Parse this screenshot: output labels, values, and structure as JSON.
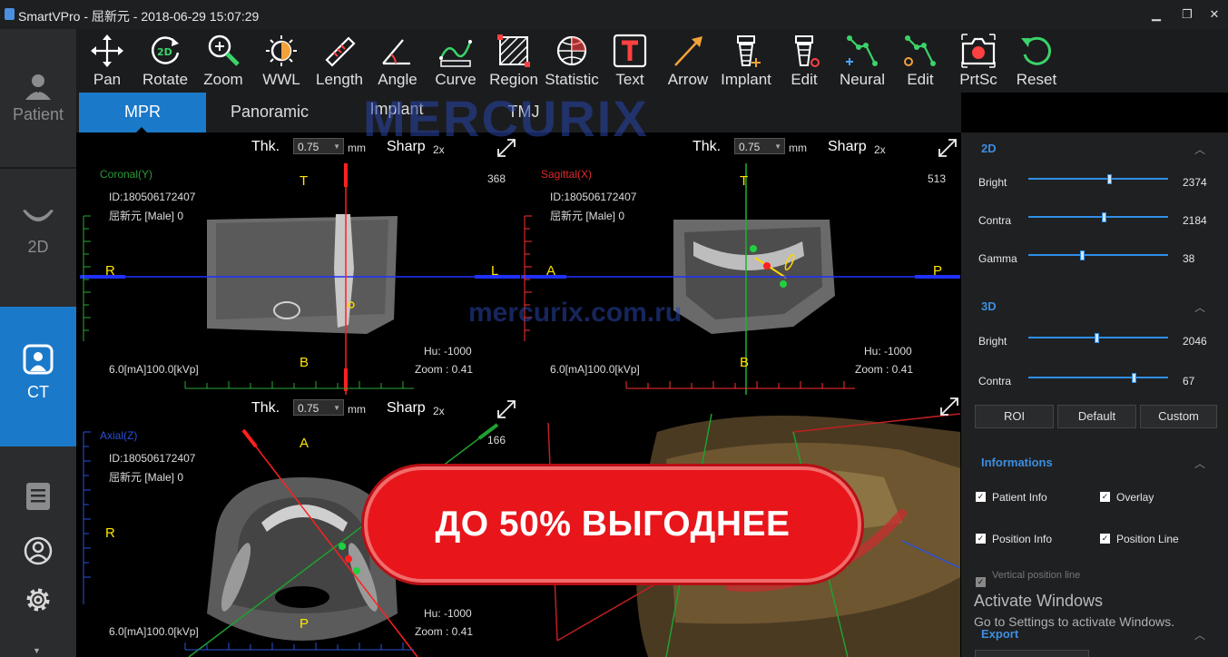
{
  "titlebar": {
    "title": "SmartVPro - 屈新元 - 2018-06-29 15:07:29",
    "min": "▁",
    "max": "❐",
    "close": "✕"
  },
  "nav": {
    "patient": "Patient",
    "twod": "2D",
    "ct": "CT",
    "report": "R",
    "accent": "#1b79c9"
  },
  "toolbar": [
    {
      "label": "Pan",
      "icon": "pan-icon"
    },
    {
      "label": "Rotate",
      "icon": "rotate-icon"
    },
    {
      "label": "Zoom",
      "icon": "zoom-icon"
    },
    {
      "label": "WWL",
      "icon": "wwl-icon"
    },
    {
      "label": "Length",
      "icon": "ruler-icon"
    },
    {
      "label": "Angle",
      "icon": "angle-icon"
    },
    {
      "label": "Curve",
      "icon": "curve-icon"
    },
    {
      "label": "Region",
      "icon": "region-icon"
    },
    {
      "label": "Statistic",
      "icon": "statistic-icon"
    },
    {
      "label": "Text",
      "icon": "text-icon"
    },
    {
      "label": "Arrow",
      "icon": "arrow-icon"
    },
    {
      "label": "Implant",
      "icon": "implant-icon"
    },
    {
      "label": "Edit",
      "icon": "implant-edit-icon"
    },
    {
      "label": "Neural",
      "icon": "neural-icon"
    },
    {
      "label": "Edit",
      "icon": "neural-edit-icon"
    },
    {
      "label": "PrtSc",
      "icon": "camera-icon"
    },
    {
      "label": "Reset",
      "icon": "reset-icon"
    }
  ],
  "tabs": [
    "MPR",
    "Panoramic",
    "Implant",
    "TMJ"
  ],
  "views": {
    "thk_label": "Thk.",
    "thk_value": "0.75",
    "mm": "mm",
    "sharp": "Sharp",
    "sharp_x": "2x",
    "patient_id": "ID:180506172407",
    "patient_name": "屈新元 [Male] 0",
    "exposure": "6.0[mA]100.0[kVp]",
    "hu": "Hu: -1000",
    "zoom": "Zoom : 0.41",
    "coronal": {
      "name": "Coronal(Y)",
      "slice": "368",
      "top": "T",
      "bottom": "B",
      "left": "R",
      "right": "L",
      "color": "#2e9a3a"
    },
    "sagittal": {
      "name": "Sagittal(X)",
      "slice": "513",
      "top": "T",
      "bottom": "B",
      "left": "A",
      "right": "P",
      "color": "#e02a2a"
    },
    "axial": {
      "name": "Axial(Z)",
      "slice": "166",
      "top": "A",
      "bottom": "P",
      "left": "R",
      "color": "#2a52d8"
    }
  },
  "panel": {
    "sec2d": "2D",
    "sec3d": "3D",
    "bright": "Bright",
    "contra": "Contra",
    "gamma": "Gamma",
    "bright2d": "2374",
    "contra2d": "2184",
    "gamma2d": "38",
    "bright3d": "2046",
    "contra3d": "67",
    "bright2d_level": 0.58,
    "contra2d_level": 0.54,
    "gamma2d_level": 0.38,
    "bright3d_level": 0.49,
    "contra3d_level": 0.75,
    "roi": "ROI",
    "default": "Default",
    "custom": "Custom",
    "informations": "Informations",
    "patient_info": "Patient Info",
    "overlay": "Overlay",
    "position_info": "Position Info",
    "position_line": "Position Line",
    "vertical_line": "Vertical position line",
    "export": "Export",
    "check": "✓"
  },
  "promo": "ДО 50% ВЫГОДНЕЕ",
  "watermark": "MERCURIX",
  "watermark_url": "mercurix.com.ru",
  "activate": {
    "line1": "Activate Windows",
    "line2": "Go to Settings to activate Windows."
  }
}
